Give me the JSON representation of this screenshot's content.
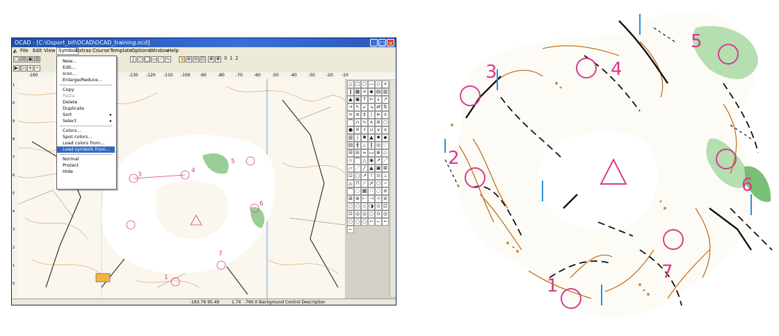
{
  "window": {
    "title": "OCAD - [C:\\Osport_bit\\OCAD\\OCAD_training.ocd]",
    "minimize": "_",
    "maximize": "□",
    "close": "×"
  },
  "menubar": {
    "items": [
      "File",
      "Edit",
      "View",
      "Symbol",
      "Extras",
      "Course",
      "Template",
      "Options",
      "Window",
      "Help"
    ]
  },
  "ruler": {
    "labels": [
      "-160",
      "-130",
      "-120",
      "-110",
      "-100",
      "-90",
      "-80",
      "-70",
      "-60",
      "-50",
      "-40",
      "-30",
      "-20",
      "-10"
    ]
  },
  "vruler": {
    "labels": [
      "1",
      "0",
      "9",
      "8",
      "7",
      "6",
      "5",
      "4",
      "3",
      "2",
      "1",
      "0"
    ]
  },
  "toolbar": {
    "zoom_values": [
      "0",
      "1",
      "2"
    ]
  },
  "symbol_menu": {
    "items": [
      {
        "label": "New...",
        "state": "normal"
      },
      {
        "label": "Edit...",
        "state": "normal"
      },
      {
        "label": "Icon...",
        "state": "normal"
      },
      {
        "label": "Enlarge/Reduce...",
        "state": "normal"
      },
      {
        "sep": true
      },
      {
        "label": "Copy",
        "state": "normal"
      },
      {
        "label": "Paste",
        "state": "disabled"
      },
      {
        "label": "Delete",
        "state": "normal"
      },
      {
        "label": "Duplicate",
        "state": "normal"
      },
      {
        "label": "Sort",
        "state": "normal",
        "submenu": true
      },
      {
        "label": "Select",
        "state": "normal",
        "submenu": true
      },
      {
        "sep": true
      },
      {
        "label": "Colors...",
        "state": "normal"
      },
      {
        "label": "Spot colors...",
        "state": "normal"
      },
      {
        "label": "Load colors from...",
        "state": "normal"
      },
      {
        "label": "Load symbols from...",
        "state": "selected"
      },
      {
        "sep": true
      },
      {
        "label": "Normal",
        "state": "normal"
      },
      {
        "label": "Protect",
        "state": "normal"
      },
      {
        "label": "Hide",
        "state": "normal"
      }
    ],
    "submenu_arrow": "▸"
  },
  "statusbar": {
    "coords": "-163.76  95.49",
    "zoom": "1.7X",
    "info": "-760.0 Background Control Description"
  },
  "left_map_controls": [
    "3",
    "4",
    "5",
    "6",
    "7",
    "1"
  ],
  "right_map": {
    "controls": [
      "1",
      "2",
      "3",
      "4",
      "5",
      "6",
      "7"
    ]
  },
  "colors": {
    "course_magenta": "#d63a8c",
    "titlebar": "#1f4fa8",
    "menu_highlight": "#316ac5",
    "contour_brown": "#c2701f",
    "vegetation_green": "#a8d8a4",
    "water_blue": "#2a8fd6"
  },
  "palette_glyphs": [
    "△",
    "□",
    "○",
    "—",
    "◇",
    "+",
    "‖",
    "▦",
    "×",
    "◆",
    "▤",
    "▥",
    "▲",
    "▣",
    "↑",
    "←",
    "↓",
    "↗",
    "→",
    "↖",
    "↙",
    "↘",
    "⇄",
    "⇅",
    "=",
    "≡",
    "‡",
    "⟩",
    "⊳",
    "∧",
    "⌒",
    "∩",
    "∿",
    "∧",
    "⊘",
    "○",
    "●",
    "✕",
    "☓",
    "∪",
    "∨",
    "ᴧ",
    "▥",
    "|",
    "✱",
    "▲",
    "✸",
    "◆",
    "▤",
    "╫",
    "⊥",
    "‖",
    "◎",
    "♡",
    "☰",
    "⊟",
    "≈",
    "▭",
    "⊕",
    "◇",
    "⬦",
    "⌒",
    "△",
    "◉",
    "↗",
    "／",
    "▱",
    "⋰",
    "╱",
    "▲",
    "▣",
    "⊠",
    "⊡",
    "□",
    "↗",
    "⊤",
    "⊙",
    "⊥",
    "◬",
    "⊓",
    "⁄",
    "〆",
    "○",
    "∼",
    "⌒",
    "◌",
    "▦",
    "∷",
    "◌",
    "≡",
    "⊞",
    "⊛",
    "⊢",
    "⊣",
    "⊹",
    "⊘",
    "○",
    "○",
    "◇",
    "◑",
    "⊙",
    "⊡",
    "⊡",
    "◎",
    "◎",
    "○",
    "⊙",
    "◎",
    "○",
    "○",
    "○",
    "⌐",
    "⌙",
    "⌐",
    "⌙"
  ]
}
